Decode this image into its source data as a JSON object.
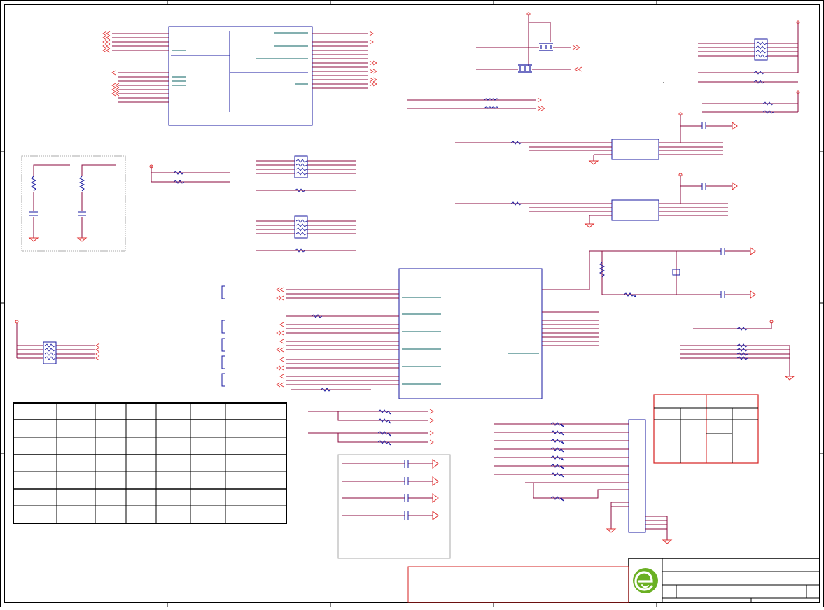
{
  "schematic": {
    "colors": {
      "wire": "#8b0a3c",
      "component": "#1a1aa0",
      "net_arrow": "#e03030",
      "frame": "#000000",
      "grid_box": "#aaaaaa",
      "highlight_table": "#d62020",
      "logo": "#6ab023"
    },
    "title_block": {
      "logo_icon": "company-logo-e-icon"
    },
    "pin_table": {
      "rows": 7,
      "columns": 7
    },
    "connector_table": {
      "rows": 5,
      "columns": 4
    }
  }
}
